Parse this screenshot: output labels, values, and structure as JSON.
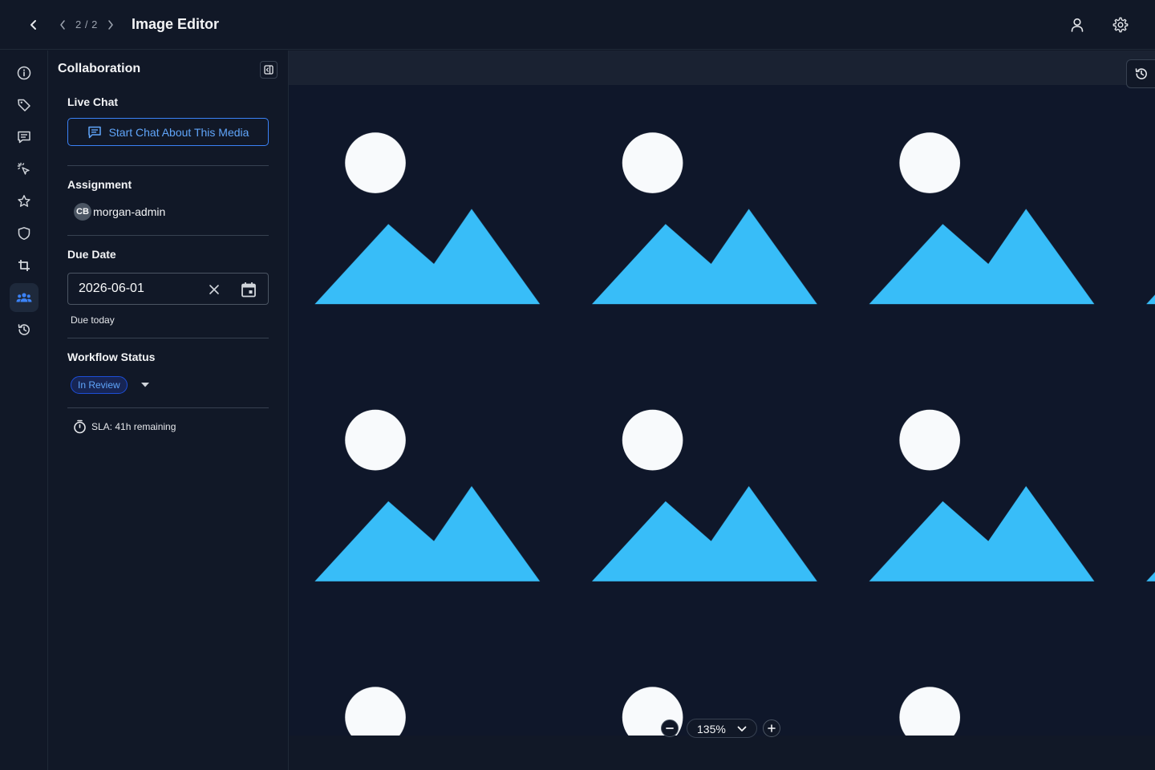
{
  "header": {
    "back_icon": "chevron-left-icon",
    "page_counter": "2 / 2",
    "title": "Image Editor",
    "user_icon": "user-icon",
    "settings_icon": "gear-icon"
  },
  "rail": {
    "items": [
      {
        "name": "info",
        "icon": "info-icon",
        "active": false
      },
      {
        "name": "tags",
        "icon": "tag-icon",
        "active": false
      },
      {
        "name": "comments",
        "icon": "comment-icon",
        "active": false
      },
      {
        "name": "ai",
        "icon": "sparkle-icon",
        "active": false
      },
      {
        "name": "favorites",
        "icon": "star-icon",
        "active": false
      },
      {
        "name": "security",
        "icon": "shield-icon",
        "active": false
      },
      {
        "name": "crop",
        "icon": "crop-icon",
        "active": false
      },
      {
        "name": "collaboration",
        "icon": "users-icon",
        "active": true
      },
      {
        "name": "history",
        "icon": "history-icon",
        "active": false
      }
    ]
  },
  "panel": {
    "title": "Collaboration",
    "live_chat": {
      "label": "Live Chat",
      "button_label": "Start Chat About This Media"
    },
    "assignment": {
      "label": "Assignment",
      "avatar_initials": "CB",
      "assignee": "morgan-admin"
    },
    "due_date": {
      "label": "Due Date",
      "value": "2026-06-01",
      "helper": "Due today"
    },
    "workflow": {
      "label": "Workflow Status",
      "status": "In Review"
    },
    "sla": "SLA: 41h remaining"
  },
  "canvas": {
    "zoom": "135%",
    "colors": {
      "background": "#0f172a",
      "sun": "#f8fafc",
      "mountain": "#38bdf8"
    }
  }
}
